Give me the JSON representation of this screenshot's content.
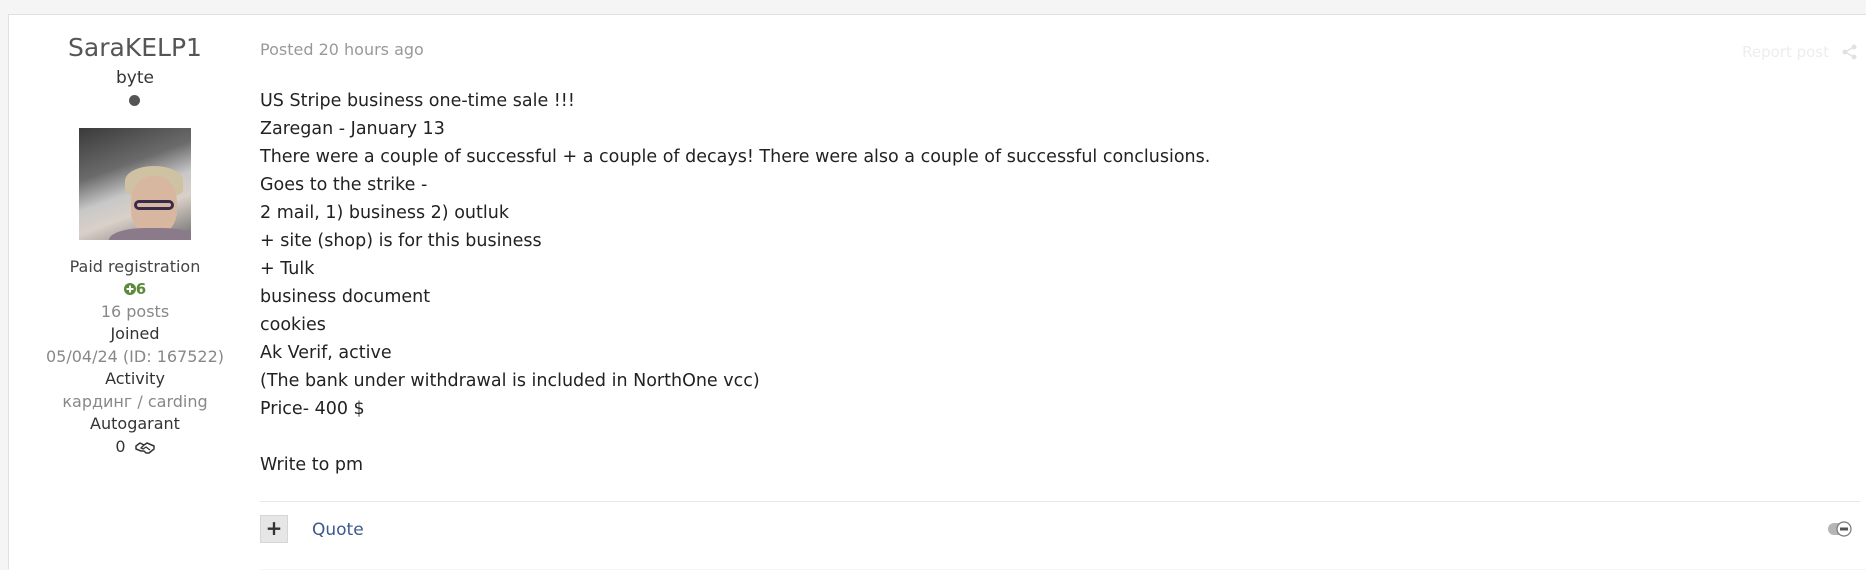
{
  "author": {
    "username": "SaraKELP1",
    "rank": "byte",
    "group": "Paid registration",
    "reputation": "6",
    "posts": "16 posts",
    "joined_label": "Joined",
    "joined_value": "05/04/24 (ID: 167522)",
    "activity_label": "Activity",
    "activity_value": "кардинг / carding",
    "autogarant_label": "Autogarant",
    "autogarant_value": "0"
  },
  "post": {
    "date_prefix": "Posted",
    "date_value": "20 hours ago",
    "report_label": "Report post",
    "lines": [
      "US Stripe business one-time sale !!!",
      "Zaregan - January 13",
      "There were a couple of successful + a couple of decays! There were also a couple of successful conclusions.",
      "Goes to the strike -",
      "2 mail, 1) business 2) outluk",
      "+ site (shop) is for this business",
      "+ Tulk",
      "business document",
      "cookies",
      "Ak Verif, active",
      "(The bank under withdrawal is included in NorthOne vcc)",
      "Price- 400 $",
      "",
      "Write to pm"
    ]
  },
  "actions": {
    "plus_label": "+",
    "quote_label": "Quote"
  },
  "icons": {
    "status": "offline-dot-icon",
    "reputation": "plus-circle-icon",
    "autogarant": "handshake-icon",
    "share": "share-icon",
    "moderation": "toggle-icon"
  },
  "colors": {
    "reputation": "#5a8a3a",
    "link": "#3a5a8a",
    "muted": "#999999"
  }
}
